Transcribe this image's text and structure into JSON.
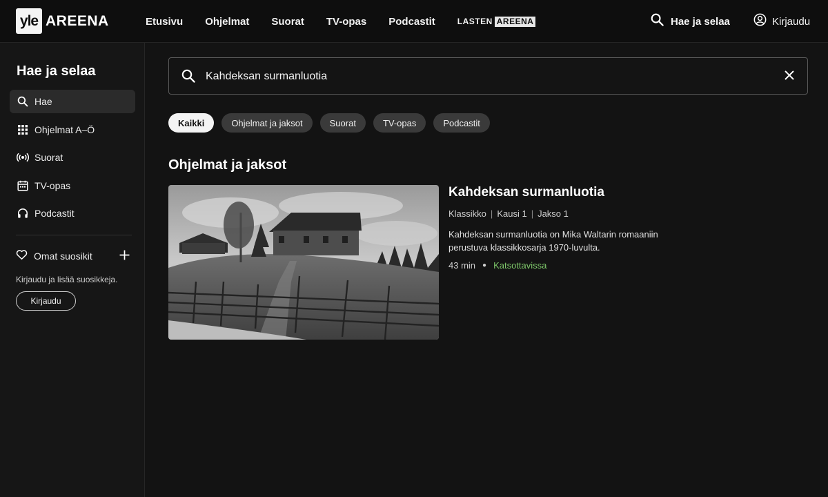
{
  "logo": {
    "yle": "yle",
    "areena": "AREENA"
  },
  "nav": {
    "items": [
      "Etusivu",
      "Ohjelmat",
      "Suorat",
      "TV-opas",
      "Podcastit"
    ],
    "lasten_prefix": "LASTEN",
    "lasten_brand": "AREENA",
    "search_label": "Hae ja selaa",
    "login_label": "Kirjaudu"
  },
  "sidebar": {
    "title": "Hae ja selaa",
    "items": [
      {
        "label": "Hae",
        "icon": "search-icon",
        "active": true
      },
      {
        "label": "Ohjelmat A–Ö",
        "icon": "grid-icon",
        "active": false
      },
      {
        "label": "Suorat",
        "icon": "broadcast-icon",
        "active": false
      },
      {
        "label": "TV-opas",
        "icon": "calendar-icon",
        "active": false
      },
      {
        "label": "Podcastit",
        "icon": "headphones-icon",
        "active": false
      }
    ],
    "favorites_label": "Omat suosikit",
    "favorites_hint": "Kirjaudu ja lisää suosikkeja.",
    "login_button": "Kirjaudu"
  },
  "search": {
    "value": "Kahdeksan surmanluotia"
  },
  "filters": {
    "chips": [
      "Kaikki",
      "Ohjelmat ja jaksot",
      "Suorat",
      "TV-opas",
      "Podcastit"
    ],
    "active_index": 0
  },
  "results": {
    "section_title": "Ohjelmat ja jaksot",
    "items": [
      {
        "title": "Kahdeksan surmanluotia",
        "meta": [
          "Klassikko",
          "Kausi 1",
          "Jakso 1"
        ],
        "description": "Kahdeksan surmanluotia on Mika Waltarin romaaniin perustuva klassikkosarja 1970-luvulta.",
        "duration": "43 min",
        "availability": "Katsottavissa"
      }
    ]
  },
  "colors": {
    "background": "#131313",
    "topbar": "#0e0e0e",
    "sidebar": "#161616",
    "chip": "#3a3a3a",
    "chip_active": "#f4f4f4",
    "available": "#7ec86a"
  }
}
